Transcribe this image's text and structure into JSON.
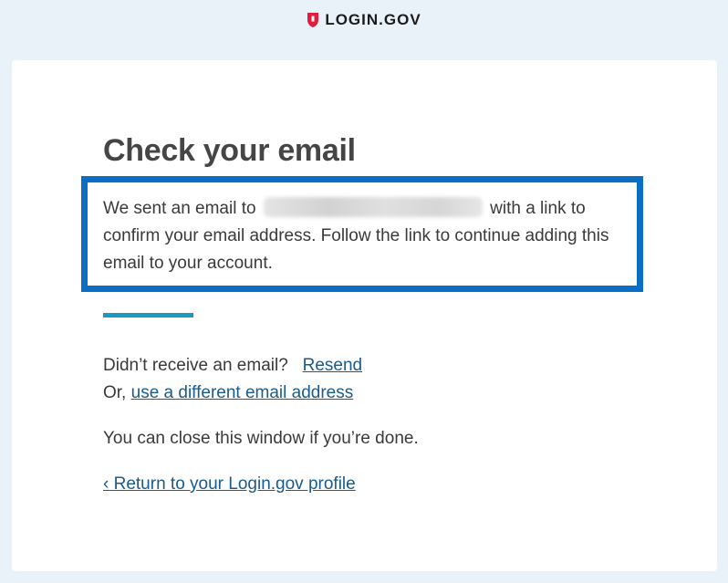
{
  "header": {
    "logo_text": "LOGIN.GOV"
  },
  "main": {
    "title": "Check your email",
    "message_prefix": "We sent an email to",
    "message_suffix": "with a link to confirm your email address. Follow the link to continue adding this email to your account.",
    "resend_prompt": "Didn’t receive an email?",
    "resend_link": "Resend",
    "alt_prefix": "Or,",
    "alt_link": "use a different email address",
    "close_text": "You can close this window if you’re done.",
    "return_link": "‹ Return to your Login.gov profile"
  },
  "colors": {
    "background": "#eaf2f9",
    "highlight_border": "#0b6ec5",
    "accent_line": "#1a98c6",
    "link": "#1a5b8f",
    "logo_red": "#e21c3d"
  }
}
